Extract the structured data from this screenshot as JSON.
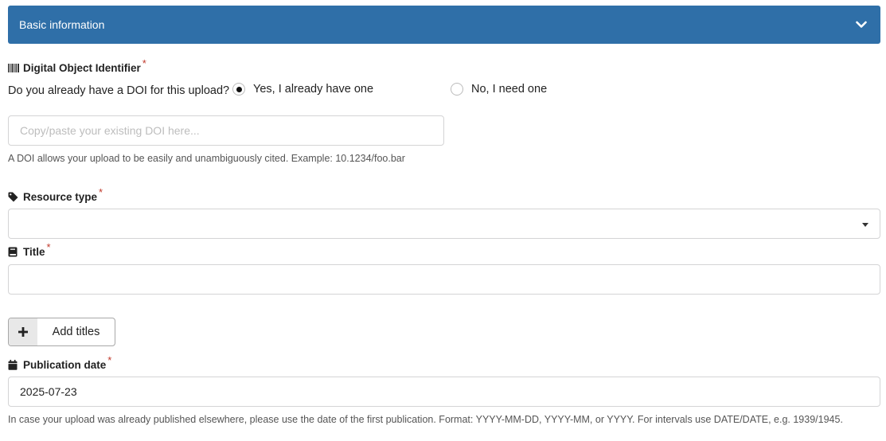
{
  "accordion": {
    "title": "Basic information",
    "icon": "chevron-down-icon"
  },
  "doi": {
    "label": "Digital Object Identifier",
    "required_mark": "*",
    "icon": "barcode-icon",
    "question": "Do you already have a DOI for this upload?",
    "options": [
      {
        "label": "Yes, I already have one",
        "checked": true
      },
      {
        "label": "No, I need one",
        "checked": false
      }
    ],
    "input_value": "",
    "input_placeholder": "Copy/paste your existing DOI here...",
    "help": "A DOI allows your upload to be easily and unambiguously cited. Example: 10.1234/foo.bar"
  },
  "resource_type": {
    "label": "Resource type",
    "required_mark": "*",
    "icon": "tag-icon",
    "selected": ""
  },
  "title": {
    "label": "Title",
    "required_mark": "*",
    "icon": "book-icon",
    "value": ""
  },
  "add_titles": {
    "label": "Add titles",
    "icon": "plus-icon"
  },
  "publication_date": {
    "label": "Publication date",
    "required_mark": "*",
    "icon": "calendar-icon",
    "value": "2025-07-23",
    "help": "In case your upload was already published elsewhere, please use the date of the first publication. Format: YYYY-MM-DD, YYYY-MM, or YYYY. For intervals use DATE/DATE, e.g. 1939/1945."
  },
  "colors": {
    "header_bg": "#2f6fa8",
    "required": "#c0392b"
  }
}
